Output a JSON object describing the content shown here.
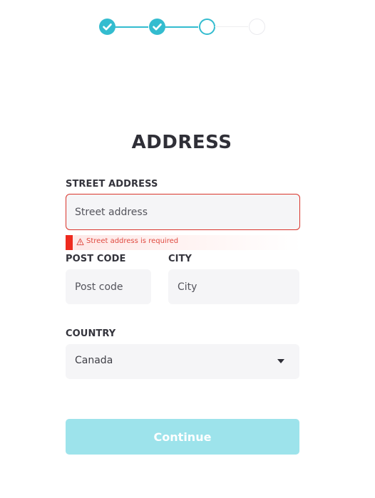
{
  "stepper": {
    "steps": [
      {
        "state": "completed",
        "icon": "check-icon"
      },
      {
        "state": "completed",
        "icon": "check-icon"
      },
      {
        "state": "current"
      },
      {
        "state": "upcoming"
      }
    ],
    "accent_color": "#33bccf"
  },
  "form": {
    "title": "ADDRESS",
    "street": {
      "label": "STREET ADDRESS",
      "placeholder": "Street address",
      "value": "",
      "error": "Street address is required",
      "error_icon": "warning-triangle-icon"
    },
    "postcode": {
      "label": "POST CODE",
      "placeholder": "Post code",
      "value": ""
    },
    "city": {
      "label": "CITY",
      "placeholder": "City",
      "value": ""
    },
    "country": {
      "label": "COUNTRY",
      "selected": "Canada",
      "icon": "chevron-down-icon"
    },
    "continue_label": "Continue"
  },
  "colors": {
    "error": "#ee2a1e",
    "button": "#9de3eb",
    "input_background": "#f5f5f7"
  }
}
